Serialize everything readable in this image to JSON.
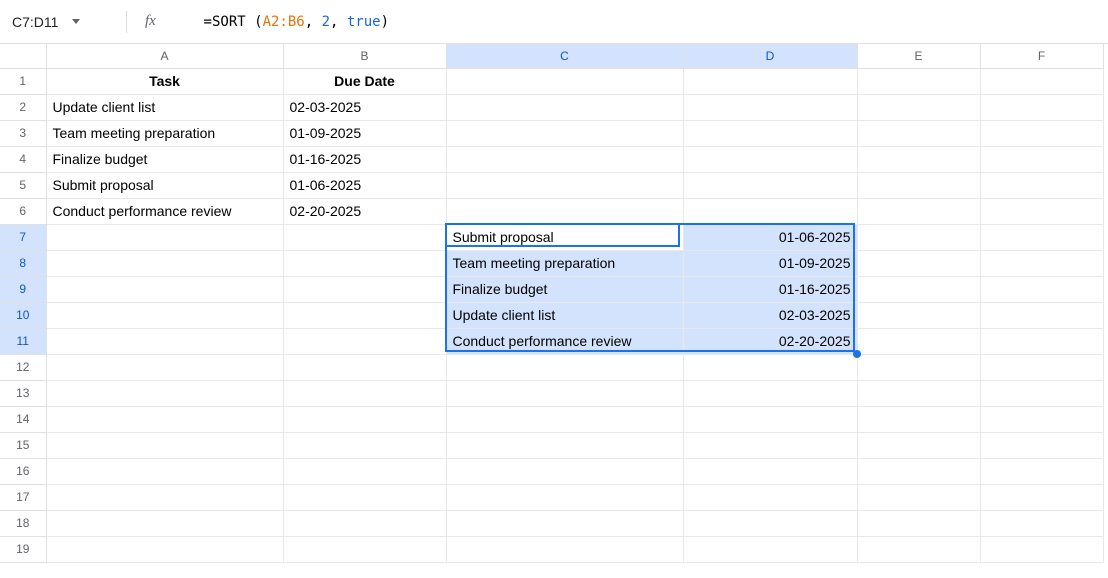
{
  "name_box": "C7:D11",
  "formula": {
    "eq": "=",
    "fn": "SORT ",
    "open": "(",
    "range": "A2:B6",
    "c1": ", ",
    "arg2": "2",
    "c2": ", ",
    "arg3": "true",
    "close": ")"
  },
  "columns": [
    "A",
    "B",
    "C",
    "D",
    "E",
    "F"
  ],
  "rows": [
    "1",
    "2",
    "3",
    "4",
    "5",
    "6",
    "7",
    "8",
    "9",
    "10",
    "11",
    "12",
    "13",
    "14",
    "15",
    "16",
    "17",
    "18",
    "19"
  ],
  "header": {
    "task": "Task",
    "due": "Due Date"
  },
  "tasks": [
    {
      "name": "Update client list",
      "due": "02-03-2025"
    },
    {
      "name": "Team meeting preparation",
      "due": "01-09-2025"
    },
    {
      "name": "Finalize budget",
      "due": "01-16-2025"
    },
    {
      "name": "Submit proposal",
      "due": "01-06-2025"
    },
    {
      "name": "Conduct performance review",
      "due": "02-20-2025"
    }
  ],
  "sorted": [
    {
      "name": "Submit proposal",
      "due": "01-06-2025"
    },
    {
      "name": "Team meeting preparation",
      "due": "01-09-2025"
    },
    {
      "name": "Finalize budget",
      "due": "01-16-2025"
    },
    {
      "name": "Update client list",
      "due": "02-03-2025"
    },
    {
      "name": "Conduct performance review",
      "due": "02-20-2025"
    }
  ]
}
